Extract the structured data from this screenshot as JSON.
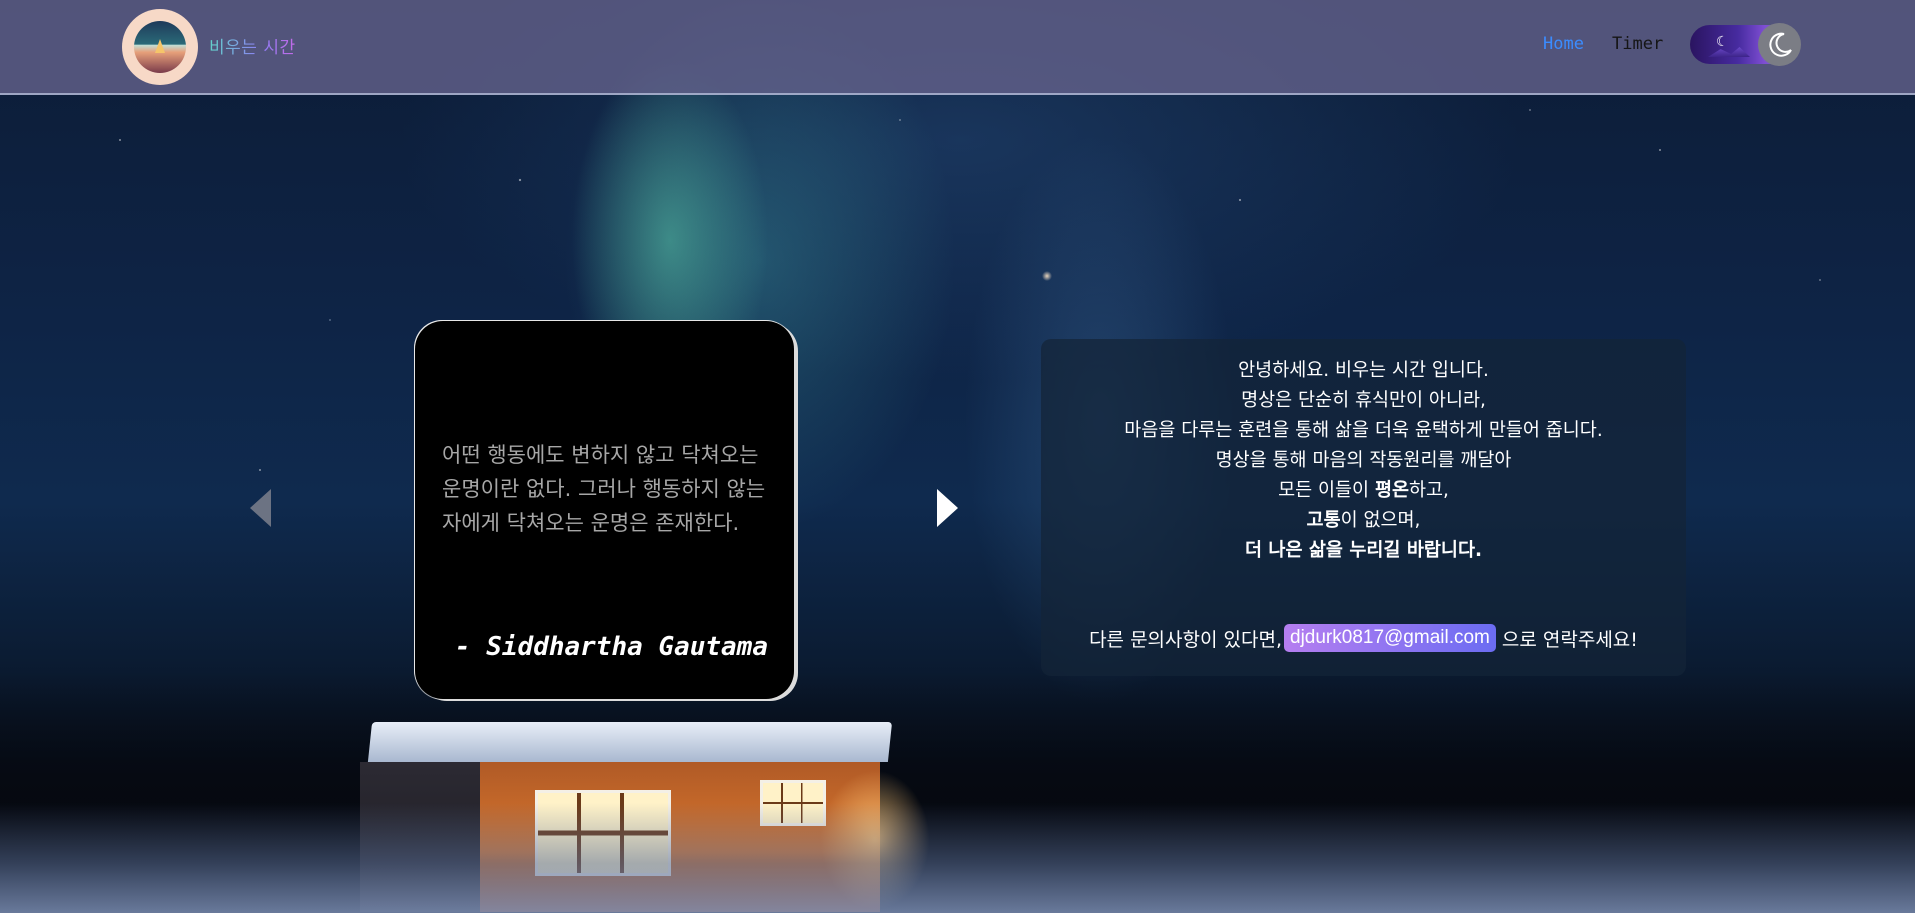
{
  "header": {
    "brand": "비우는 시간",
    "nav": {
      "home": "Home",
      "timer": "Timer"
    },
    "theme_toggle": {
      "state": "dark",
      "icon": "moon-icon"
    },
    "colors": {
      "active_nav": "#3b8cff"
    }
  },
  "quote": {
    "text": "어떤 행동에도 변하지 않고 닥쳐오는 운명이란 없다. 그러나 행동하지 않는 자에게 닥쳐오는 운명은 존재한다.",
    "author": "- Siddhartha Gautama"
  },
  "intro": {
    "line1": "안녕하세요. 비우는 시간 입니다.",
    "line2": "명상은 단순히 휴식만이 아니라,",
    "line3": "마음을 다루는 훈련을 통해 삶을 더욱 윤택하게 만들어 줍니다.",
    "line4": "명상을 통해 마음의 작동원리를 깨달아",
    "line5_pre": "모든 이들이 ",
    "line5_bold": "평온",
    "line5_post": "하고,",
    "line6_bold": "고통",
    "line6_post": "이 없으며,",
    "line7": "더 나은 삶을 누리길 바랍니다.",
    "contact_pre": "다른 문의사항이 있다면,",
    "email": "djdurk0817@gmail.com",
    "contact_post": "으로 연락주세요!"
  }
}
